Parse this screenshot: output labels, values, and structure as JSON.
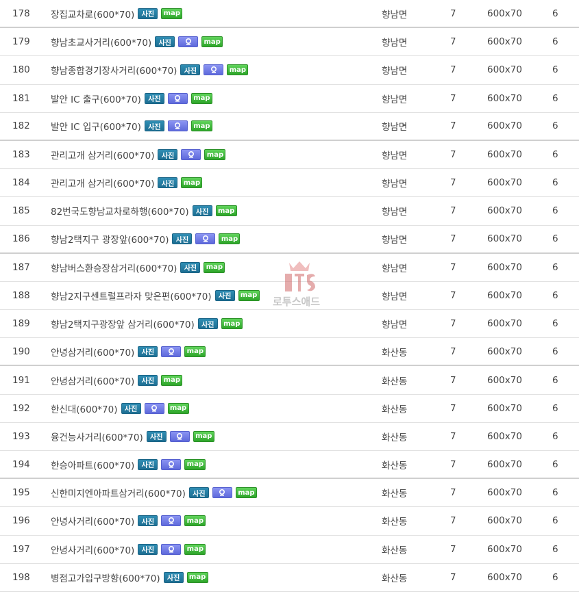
{
  "listing": {
    "rows": [
      {
        "no": "178",
        "name": "장집교차로(600*70)",
        "photo": "사진",
        "view": false,
        "map": "map",
        "area": "향남면",
        "qty": "7",
        "size": "600x70",
        "count": "6",
        "groupEnd": true
      },
      {
        "no": "179",
        "name": "향남초교사거리(600*70)",
        "photo": "사진",
        "view": true,
        "map": "map",
        "area": "향남면",
        "qty": "7",
        "size": "600x70",
        "count": "6",
        "groupEnd": false
      },
      {
        "no": "180",
        "name": "향남종합경기장사거리(600*70)",
        "photo": "사진",
        "view": true,
        "map": "map",
        "area": "향남면",
        "qty": "7",
        "size": "600x70",
        "count": "6",
        "groupEnd": false
      },
      {
        "no": "181",
        "name": "발안 IC 출구(600*70)",
        "photo": "사진",
        "view": true,
        "map": "map",
        "area": "향남면",
        "qty": "7",
        "size": "600x70",
        "count": "6",
        "groupEnd": false
      },
      {
        "no": "182",
        "name": "발안 IC 입구(600*70)",
        "photo": "사진",
        "view": true,
        "map": "map",
        "area": "향남면",
        "qty": "7",
        "size": "600x70",
        "count": "6",
        "groupEnd": true
      },
      {
        "no": "183",
        "name": "관리고개 삼거리(600*70)",
        "photo": "사진",
        "view": true,
        "map": "map",
        "area": "향남면",
        "qty": "7",
        "size": "600x70",
        "count": "6",
        "groupEnd": false
      },
      {
        "no": "184",
        "name": "관리고개 삼거리(600*70)",
        "photo": "사진",
        "view": false,
        "map": "map",
        "area": "향남면",
        "qty": "7",
        "size": "600x70",
        "count": "6",
        "groupEnd": false
      },
      {
        "no": "185",
        "name": "82번국도향남교차로하행(600*70)",
        "photo": "사진",
        "view": false,
        "map": "map",
        "area": "향남면",
        "qty": "7",
        "size": "600x70",
        "count": "6",
        "groupEnd": false
      },
      {
        "no": "186",
        "name": "향남2택지구 광장앞(600*70)",
        "photo": "사진",
        "view": true,
        "map": "map",
        "area": "향남면",
        "qty": "7",
        "size": "600x70",
        "count": "6",
        "groupEnd": true
      },
      {
        "no": "187",
        "name": "향남버스환승장삼거리(600*70)",
        "photo": "사진",
        "view": false,
        "map": "map",
        "area": "향남면",
        "qty": "7",
        "size": "600x70",
        "count": "6",
        "groupEnd": false
      },
      {
        "no": "188",
        "name": "향남2지구센트럴프라자 맞은편(600*70)",
        "photo": "사진",
        "view": false,
        "map": "map",
        "area": "향남면",
        "qty": "7",
        "size": "600x70",
        "count": "6",
        "groupEnd": false
      },
      {
        "no": "189",
        "name": "향남2택지구광장앞 삼거리(600*70)",
        "photo": "사진",
        "view": false,
        "map": "map",
        "area": "향남면",
        "qty": "7",
        "size": "600x70",
        "count": "6",
        "groupEnd": false
      },
      {
        "no": "190",
        "name": "안녕삼거리(600*70)",
        "photo": "사진",
        "view": true,
        "map": "map",
        "area": "화산동",
        "qty": "7",
        "size": "600x70",
        "count": "6",
        "groupEnd": true
      },
      {
        "no": "191",
        "name": "안녕삼거리(600*70)",
        "photo": "사진",
        "view": false,
        "map": "map",
        "area": "화산동",
        "qty": "7",
        "size": "600x70",
        "count": "6",
        "groupEnd": false
      },
      {
        "no": "192",
        "name": "한신대(600*70)",
        "photo": "사진",
        "view": true,
        "map": "map",
        "area": "화산동",
        "qty": "7",
        "size": "600x70",
        "count": "6",
        "groupEnd": false
      },
      {
        "no": "193",
        "name": "융건능사거리(600*70)",
        "photo": "사진",
        "view": true,
        "map": "map",
        "area": "화산동",
        "qty": "7",
        "size": "600x70",
        "count": "6",
        "groupEnd": false
      },
      {
        "no": "194",
        "name": "한승아파트(600*70)",
        "photo": "사진",
        "view": true,
        "map": "map",
        "area": "화산동",
        "qty": "7",
        "size": "600x70",
        "count": "6",
        "groupEnd": true
      },
      {
        "no": "195",
        "name": "신한미지엔아파트삼거리(600*70)",
        "photo": "사진",
        "view": true,
        "map": "map",
        "area": "화산동",
        "qty": "7",
        "size": "600x70",
        "count": "6",
        "groupEnd": false
      },
      {
        "no": "196",
        "name": "안녕사거리(600*70)",
        "photo": "사진",
        "view": true,
        "map": "map",
        "area": "화산동",
        "qty": "7",
        "size": "600x70",
        "count": "6",
        "groupEnd": false
      },
      {
        "no": "197",
        "name": "안녕사거리(600*70)",
        "photo": "사진",
        "view": true,
        "map": "map",
        "area": "화산동",
        "qty": "7",
        "size": "600x70",
        "count": "6",
        "groupEnd": false
      },
      {
        "no": "198",
        "name": "병점고가입구방향(600*70)",
        "photo": "사진",
        "view": false,
        "map": "map",
        "area": "화산동",
        "qty": "7",
        "size": "600x70",
        "count": "6",
        "groupEnd": false
      }
    ]
  },
  "watermark": {
    "text": "로투스애드",
    "logo": "lts-crown-logo"
  },
  "colors": {
    "photo_badge": "#1e6f93",
    "map_badge": "#2ea52a",
    "view_badge": "#5e69db",
    "divider": "#e2e2e2"
  },
  "icons": {
    "view": "street-view-icon"
  }
}
